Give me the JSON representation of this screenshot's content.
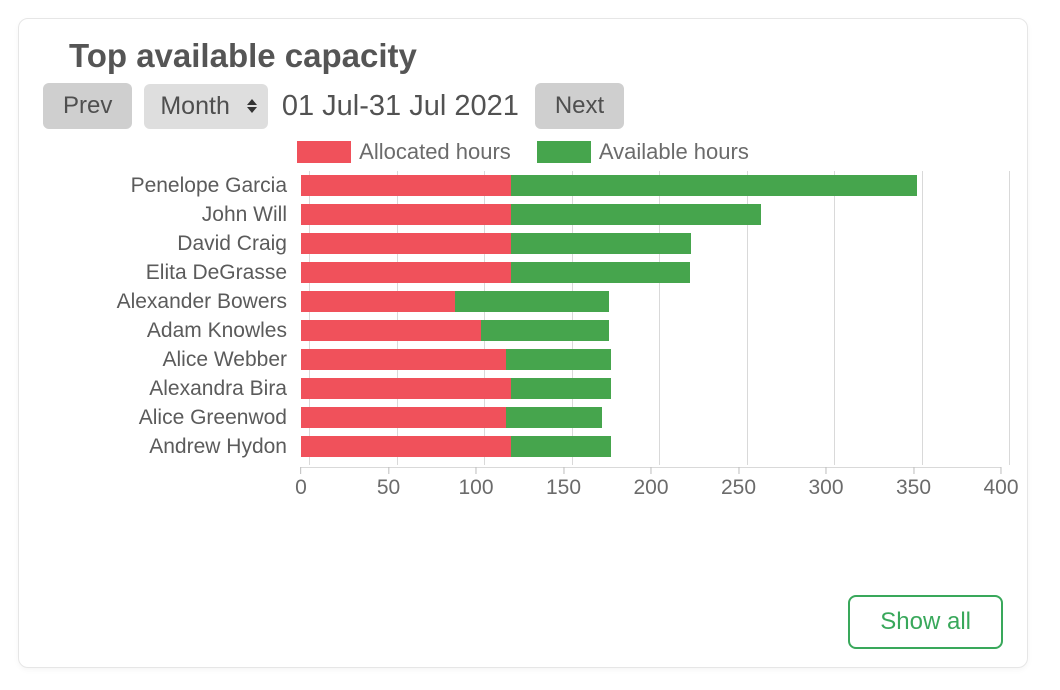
{
  "header": {
    "title": "Top available capacity",
    "prev_label": "Prev",
    "next_label": "Next",
    "date_range": "01 Jul-31 Jul 2021",
    "period_selected": "Month"
  },
  "legend": {
    "series1": "Allocated hours",
    "series2": "Available hours"
  },
  "colors": {
    "allocated": "#f0515b",
    "available": "#46a54d",
    "grid": "#d9d9d9",
    "btn_outline": "#39a85b"
  },
  "footer": {
    "show_all": "Show all"
  },
  "chart_data": {
    "type": "bar",
    "orientation": "horizontal",
    "stacked": true,
    "xlabel": "",
    "ylabel": "",
    "xlim": [
      0,
      400
    ],
    "xticks": [
      0,
      50,
      100,
      150,
      200,
      250,
      300,
      350,
      400
    ],
    "legend_position": "top",
    "categories": [
      "Penelope Garcia",
      "John Will",
      "David Craig",
      "Elita DeGrasse",
      "Alexander Bowers",
      "Adam Knowles",
      "Alice Webber",
      "Alexandra Bira",
      "Alice Greenwod",
      "Andrew Hydon"
    ],
    "series": [
      {
        "name": "Allocated hours",
        "values": [
          120,
          120,
          120,
          120,
          88,
          103,
          117,
          120,
          117,
          120
        ]
      },
      {
        "name": "Available hours",
        "values": [
          232,
          143,
          103,
          102,
          88,
          73,
          60,
          57,
          55,
          57
        ]
      }
    ]
  }
}
